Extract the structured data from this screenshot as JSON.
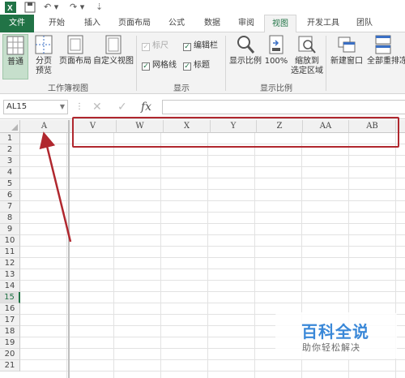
{
  "ribbon_tabs": [
    "文件",
    "开始",
    "插入",
    "页面布局",
    "公式",
    "数据",
    "审阅",
    "视图",
    "开发工具",
    "团队"
  ],
  "active_tab": "视图",
  "workbook_views": {
    "normal": "普通",
    "page_break_preview": [
      "分页",
      "预览"
    ],
    "page_layout": "页面布局",
    "custom_views": "自定义视图",
    "group_label": "工作簿视图"
  },
  "show": {
    "ruler": "标尺",
    "formula_bar": "编辑栏",
    "gridlines": "网格线",
    "headings": "标题",
    "group_label": "显示"
  },
  "zoom": {
    "zoom": "显示比例",
    "hundred": "100%",
    "zoom_to_selection": [
      "缩放到",
      "选定区域"
    ],
    "group_label": "显示比例"
  },
  "window": {
    "new_window": "新建窗口",
    "arrange_all": "全部重排",
    "freeze_partial": "冻"
  },
  "name_box": "AL15",
  "fx_label": "fx",
  "columns": [
    "A",
    "V",
    "W",
    "X",
    "Y",
    "Z",
    "AA",
    "AB"
  ],
  "rows": [
    "1",
    "2",
    "3",
    "4",
    "5",
    "6",
    "7",
    "8",
    "9",
    "10",
    "11",
    "12",
    "13",
    "14",
    "15",
    "16",
    "17",
    "18",
    "19",
    "20",
    "21"
  ],
  "active_row": "15",
  "watermark": {
    "title": "百科全说",
    "subtitle": "助你轻松解决"
  },
  "colors": {
    "accent": "#217346",
    "annotation": "#b0272e",
    "watermark": "#3a88d8"
  }
}
